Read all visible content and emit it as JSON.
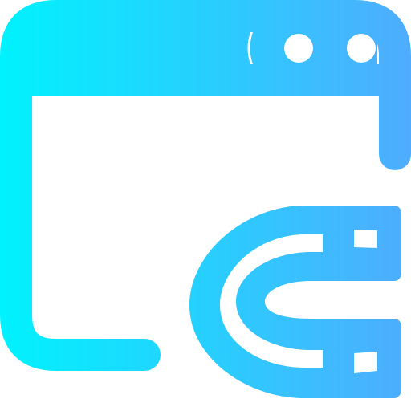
{
  "icon": {
    "name": "browser-window-magnet-icon",
    "gradient_start": "#00F2FE",
    "gradient_end": "#4FACFE",
    "background": "#FFFFFF"
  }
}
